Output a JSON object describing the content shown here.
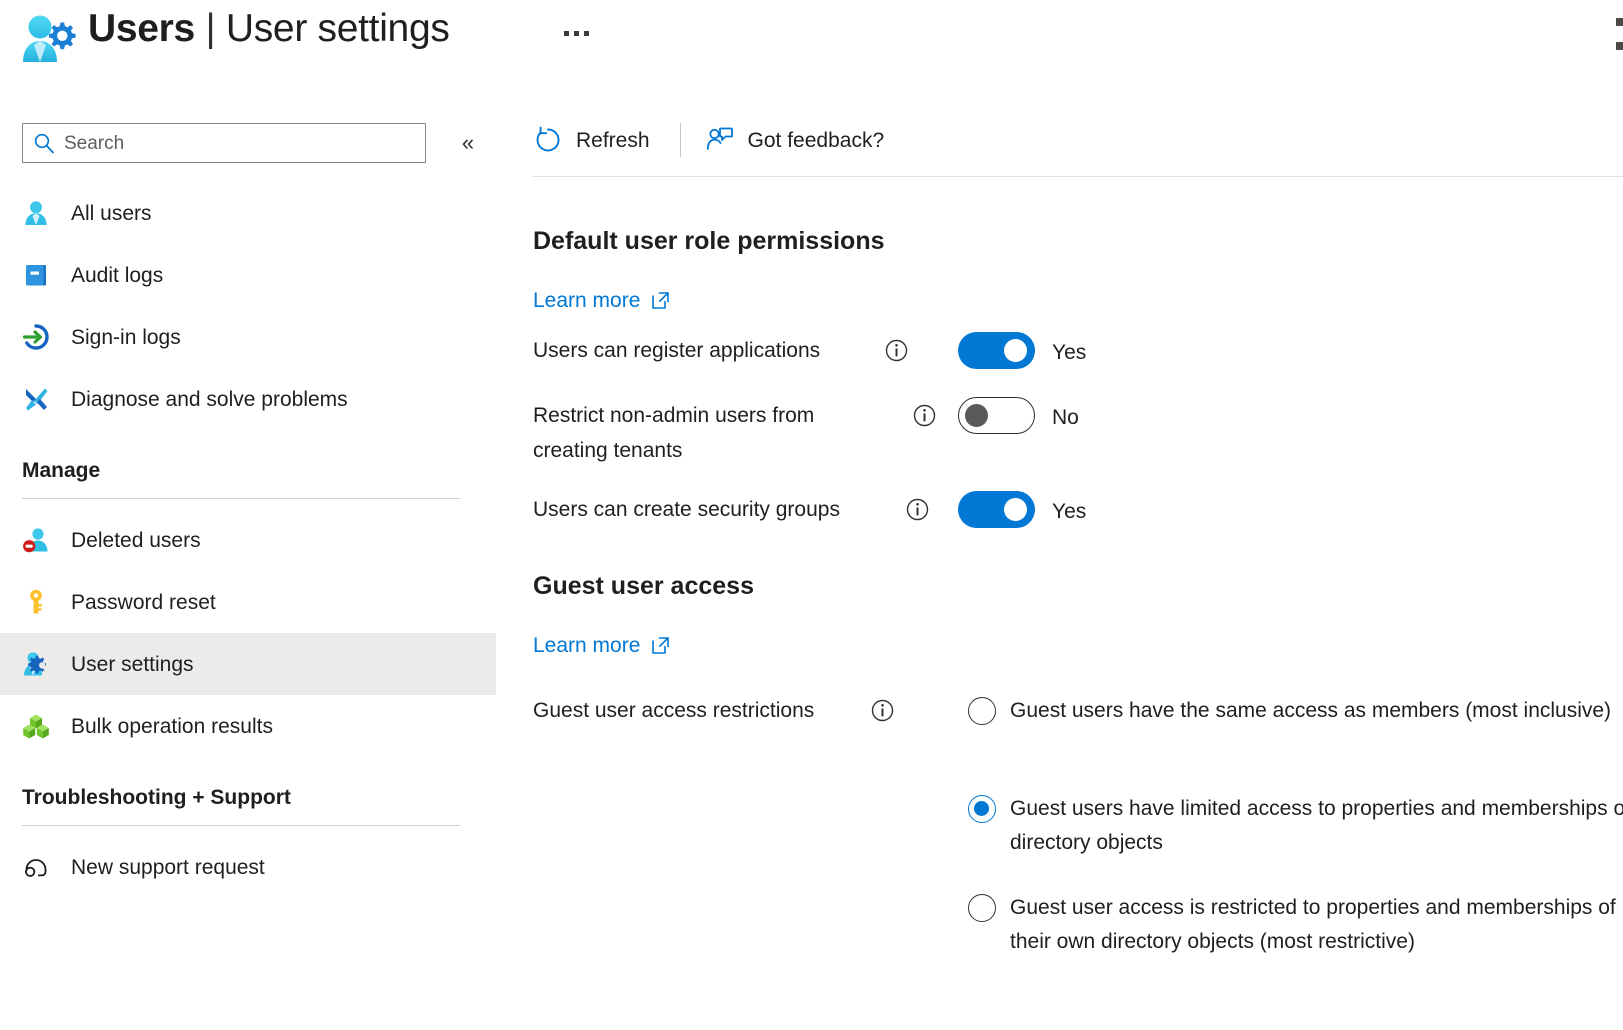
{
  "header": {
    "icon": "users-settings-icon",
    "title_main": "Users",
    "title_separator": "|",
    "title_sub": "User settings",
    "overflow_menu": "…"
  },
  "sidebar": {
    "search": {
      "placeholder": "Search",
      "icon": "search-icon"
    },
    "collapse": {
      "icon": "chevron-double-left-icon",
      "glyph": "«"
    },
    "items": [
      {
        "label": "All users",
        "icon": "user-icon",
        "selected": false
      },
      {
        "label": "Audit logs",
        "icon": "book-icon",
        "selected": false
      },
      {
        "label": "Sign-in logs",
        "icon": "sign-in-arrow-icon",
        "selected": false
      },
      {
        "label": "Diagnose and solve problems",
        "icon": "wrench-screwdriver-icon",
        "selected": false
      }
    ],
    "groups": [
      {
        "title": "Manage",
        "items": [
          {
            "label": "Deleted users",
            "icon": "user-blocked-icon",
            "selected": false
          },
          {
            "label": "Password reset",
            "icon": "key-icon",
            "selected": false
          },
          {
            "label": "User settings",
            "icon": "user-settings-icon",
            "selected": true
          },
          {
            "label": "Bulk operation results",
            "icon": "cubes-icon",
            "selected": false
          }
        ]
      },
      {
        "title": "Troubleshooting + Support",
        "items": [
          {
            "label": "New support request",
            "icon": "support-headset-icon",
            "selected": false
          }
        ]
      }
    ]
  },
  "toolbar": {
    "refresh_label": "Refresh",
    "refresh_icon": "refresh-icon",
    "feedback_label": "Got feedback?",
    "feedback_icon": "person-comment-icon"
  },
  "main": {
    "permissions_section": {
      "heading": "Default user role permissions",
      "learn_more": "Learn more",
      "learn_more_icon": "external-link-icon",
      "settings": [
        {
          "label": "Users can register applications",
          "info_icon": "info-icon",
          "state": "on",
          "value": "Yes"
        },
        {
          "label": "Restrict non-admin users from creating tenants",
          "info_icon": "info-icon",
          "state": "off",
          "value": "No"
        },
        {
          "label": "Users can create security groups",
          "info_icon": "info-icon",
          "state": "on",
          "value": "Yes"
        }
      ]
    },
    "guest_section": {
      "heading": "Guest user access",
      "learn_more": "Learn more",
      "learn_more_icon": "external-link-icon",
      "restrictions_label": "Guest user access restrictions",
      "restrictions_info_icon": "info-icon",
      "options": [
        {
          "label": "Guest users have the same access as members (most inclusive)",
          "checked": false
        },
        {
          "label": "Guest users have limited access to properties and memberships of directory objects",
          "checked": true
        },
        {
          "label": "Guest user access is restricted to properties and memberships of their own directory objects (most restrictive)",
          "checked": false
        }
      ]
    }
  },
  "colors": {
    "accent": "#0078d4",
    "selected_row": "#edebe9",
    "text": "#201f1e",
    "border": "#8a8886"
  }
}
